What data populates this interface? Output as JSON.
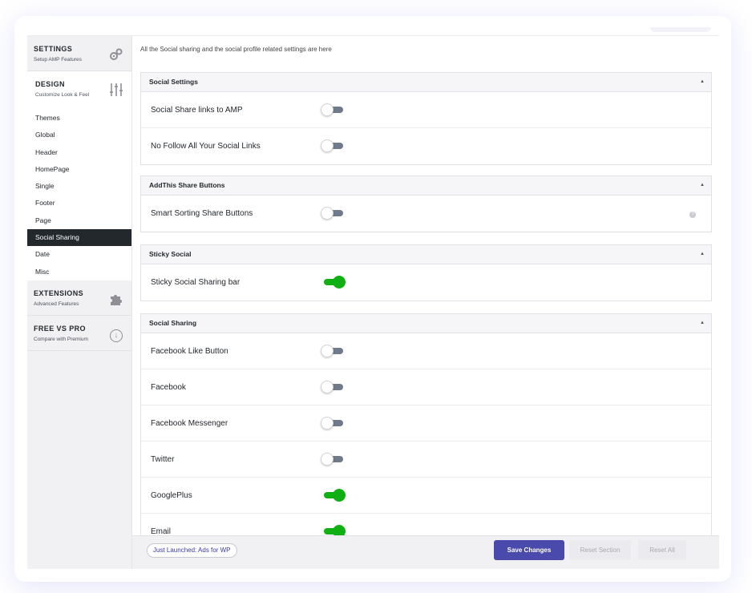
{
  "intro_text": "All the Social sharing and the social profile related settings are here",
  "sidebar": {
    "settings": {
      "title": "SETTINGS",
      "subtitle": "Setup AMP Features",
      "icon": "gears-icon"
    },
    "design": {
      "title": "DESIGN",
      "subtitle": "Customize Look & Feel",
      "icon": "sliders-icon"
    },
    "design_items": [
      "Themes",
      "Global",
      "Header",
      "HomePage",
      "Single",
      "Footer",
      "Page",
      "Social Sharing",
      "Date",
      "Misc"
    ],
    "active_item": "Social Sharing",
    "extensions": {
      "title": "EXTENSIONS",
      "subtitle": "Advanced Features",
      "icon": "puzzle-icon"
    },
    "free_vs_pro": {
      "title": "FREE VS PRO",
      "subtitle": "Compare with Premium",
      "icon": "download-circle-icon"
    }
  },
  "panels": {
    "social_settings": {
      "title": "Social Settings",
      "rows": [
        {
          "label": "Social Share links to AMP",
          "enabled": false
        },
        {
          "label": "No Follow All Your Social Links",
          "enabled": false
        }
      ]
    },
    "addthis": {
      "title": "AddThis Share Buttons",
      "rows": [
        {
          "label": "Smart Sorting Share Buttons",
          "enabled": false,
          "help_icon": "help-icon"
        }
      ]
    },
    "sticky_social": {
      "title": "Sticky Social",
      "rows": [
        {
          "label": "Sticky Social Sharing bar",
          "enabled": true
        }
      ]
    },
    "social_sharing": {
      "title": "Social Sharing",
      "rows": [
        {
          "label": "Facebook Like Button",
          "enabled": false
        },
        {
          "label": "Facebook",
          "enabled": false
        },
        {
          "label": "Facebook Messenger",
          "enabled": false
        },
        {
          "label": "Twitter",
          "enabled": false
        },
        {
          "label": "GooglePlus",
          "enabled": true
        },
        {
          "label": "Email",
          "enabled": true
        }
      ]
    }
  },
  "footer": {
    "promo": "Just Launched: Ads for WP",
    "save": "Save Changes",
    "reset_section": "Reset Section",
    "reset_all": "Reset All"
  },
  "colors": {
    "toggle_on": "#10b014",
    "toggle_off_track": "#6f7a8b",
    "active_menu": "#23282d",
    "primary_button": "#4a4aad"
  }
}
